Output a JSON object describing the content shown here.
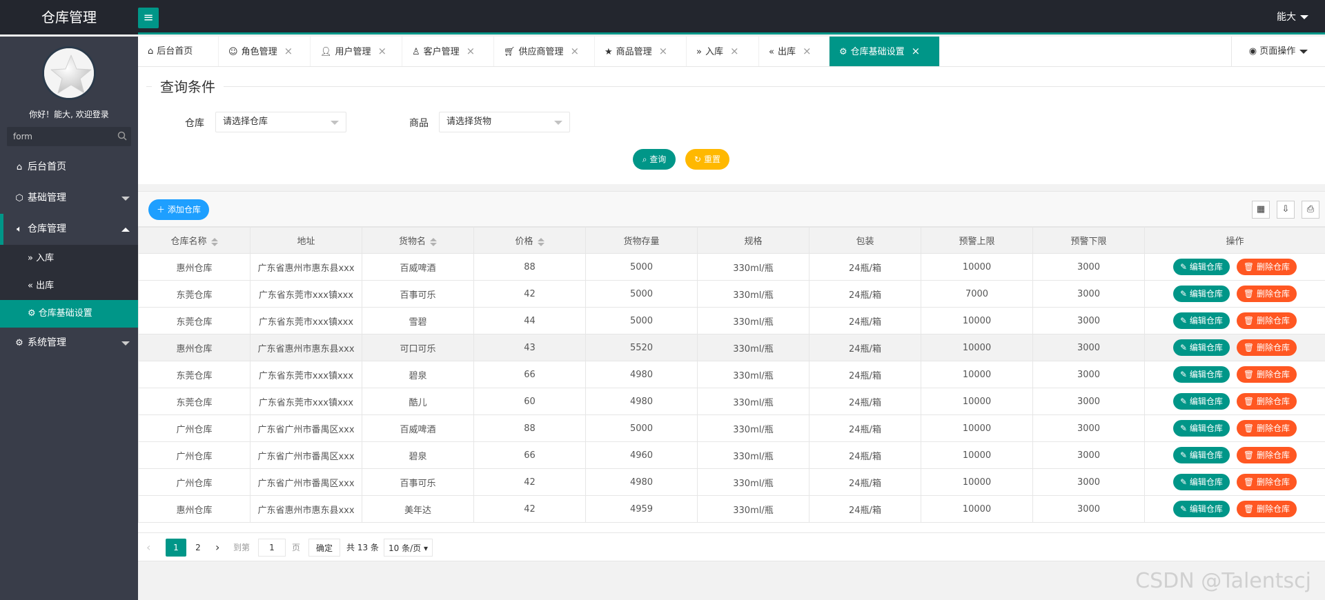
{
  "app": {
    "title": "仓库管理",
    "user": "能大"
  },
  "sidebar": {
    "welcome": "你好！能大, 欢迎登录",
    "search_value": "form",
    "items": [
      {
        "label": "后台首页",
        "icon": "home-icon"
      },
      {
        "label": "基础管理",
        "icon": "cube-icon"
      },
      {
        "label": "仓库管理",
        "icon": "speaker-icon",
        "children": [
          {
            "label": "入库",
            "icon": "double-right-icon"
          },
          {
            "label": "出库",
            "icon": "double-left-icon"
          },
          {
            "label": "仓库基础设置",
            "icon": "gear-icon",
            "active": true
          }
        ]
      },
      {
        "label": "系统管理",
        "icon": "gear-icon"
      }
    ]
  },
  "tabs": [
    {
      "label": "后台首页",
      "icon": "home-icon",
      "closable": false
    },
    {
      "label": "角色管理",
      "icon": "smile-icon",
      "closable": true
    },
    {
      "label": "用户管理",
      "icon": "user-icon",
      "closable": true
    },
    {
      "label": "客户管理",
      "icon": "user-outline-icon",
      "closable": true
    },
    {
      "label": "供应商管理",
      "icon": "cart-icon",
      "closable": true
    },
    {
      "label": "商品管理",
      "icon": "star-icon",
      "closable": true
    },
    {
      "label": "入库",
      "icon": "double-right-icon",
      "closable": true
    },
    {
      "label": "出库",
      "icon": "double-left-icon",
      "closable": true
    },
    {
      "label": "仓库基础设置",
      "icon": "gear-icon",
      "closable": true,
      "active": true
    }
  ],
  "page_ops": "页面操作",
  "query": {
    "legend": "查询条件",
    "warehouse_label": "仓库",
    "warehouse_placeholder": "请选择仓库",
    "goods_label": "商品",
    "goods_placeholder": "请选择货物",
    "search_btn": "查询",
    "reset_btn": "重置"
  },
  "toolbar": {
    "add_btn": "添加仓库"
  },
  "table": {
    "columns": [
      "仓库名称",
      "地址",
      "货物名",
      "价格",
      "货物存量",
      "规格",
      "包装",
      "预警上限",
      "预警下限",
      "操作"
    ],
    "edit_label": "编辑仓库",
    "delete_label": "删除仓库",
    "rows": [
      [
        "惠州仓库",
        "广东省惠州市惠东县xxx",
        "百威啤酒",
        "88",
        "5000",
        "330ml/瓶",
        "24瓶/箱",
        "10000",
        "3000"
      ],
      [
        "东莞仓库",
        "广东省东莞市xxx镇xxx",
        "百事可乐",
        "42",
        "5000",
        "330ml/瓶",
        "24瓶/箱",
        "7000",
        "3000"
      ],
      [
        "东莞仓库",
        "广东省东莞市xxx镇xxx",
        "雪碧",
        "44",
        "5000",
        "330ml/瓶",
        "24瓶/箱",
        "10000",
        "3000"
      ],
      [
        "惠州仓库",
        "广东省惠州市惠东县xxx",
        "可口可乐",
        "43",
        "5520",
        "330ml/瓶",
        "24瓶/箱",
        "10000",
        "3000"
      ],
      [
        "东莞仓库",
        "广东省东莞市xxx镇xxx",
        "碧泉",
        "66",
        "4980",
        "330ml/瓶",
        "24瓶/箱",
        "10000",
        "3000"
      ],
      [
        "东莞仓库",
        "广东省东莞市xxx镇xxx",
        "酷儿",
        "60",
        "4980",
        "330ml/瓶",
        "24瓶/箱",
        "10000",
        "3000"
      ],
      [
        "广州仓库",
        "广东省广州市番禺区xxx",
        "百威啤酒",
        "88",
        "5000",
        "330ml/瓶",
        "24瓶/箱",
        "10000",
        "3000"
      ],
      [
        "广州仓库",
        "广东省广州市番禺区xxx",
        "碧泉",
        "66",
        "4960",
        "330ml/瓶",
        "24瓶/箱",
        "10000",
        "3000"
      ],
      [
        "广州仓库",
        "广东省广州市番禺区xxx",
        "百事可乐",
        "42",
        "4980",
        "330ml/瓶",
        "24瓶/箱",
        "10000",
        "3000"
      ],
      [
        "惠州仓库",
        "广东省惠州市惠东县xxx",
        "美年达",
        "42",
        "4959",
        "330ml/瓶",
        "24瓶/箱",
        "10000",
        "3000"
      ]
    ]
  },
  "pager": {
    "pages": [
      "1",
      "2"
    ],
    "goto_label": "到第",
    "page_value": "1",
    "page_unit": "页",
    "confirm": "确定",
    "total": "共 13 条",
    "page_size": "10 条/页"
  },
  "watermark": "CSDN @Talentscj",
  "colors": {
    "primary": "#009688",
    "header": "#23262e",
    "sidebar": "#393d49",
    "warning": "#ffb800",
    "danger": "#ff5722",
    "info": "#1e9fff"
  }
}
